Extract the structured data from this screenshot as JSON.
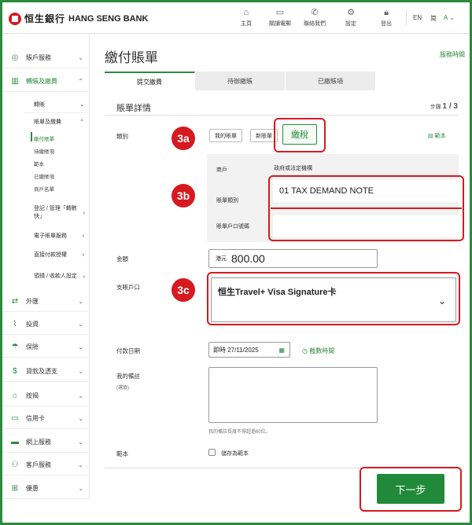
{
  "header": {
    "logo_cn": "恒生銀行",
    "logo_en": "HANG SENG BANK",
    "nav": [
      {
        "icon": "home-icon",
        "label": "主頁"
      },
      {
        "icon": "card-icon",
        "label": "關讀電郵"
      },
      {
        "icon": "phone-icon",
        "label": "聯絡我們"
      },
      {
        "icon": "gear-icon",
        "label": "設定"
      },
      {
        "icon": "lock-icon",
        "label": "登出"
      }
    ],
    "lang_en": "EN",
    "lang_sc": "简",
    "font_size": "A"
  },
  "sidebar": {
    "items": [
      {
        "icon": "user-icon",
        "label": "賬戶服務"
      },
      {
        "icon": "transfer-icon",
        "label": "轉賬及繳費"
      }
    ],
    "sub": [
      {
        "label": "轉賬"
      },
      {
        "label": "賬單及繳費"
      }
    ],
    "sub3": [
      "繳付賬單",
      "待繳賬項",
      "範本",
      "已繳賬項",
      "商戶名單"
    ],
    "sub_more": [
      "登記 / 管理「轉數快」",
      "電子賬單服務",
      "直接付款授權",
      "領錢 / 收款人設定"
    ],
    "bottom": [
      {
        "icon": "fx-icon",
        "label": "外匯"
      },
      {
        "icon": "chart-icon",
        "label": "投資"
      },
      {
        "icon": "umbrella-icon",
        "label": "保險"
      },
      {
        "icon": "money-icon",
        "label": "貸款及透支"
      },
      {
        "icon": "house-icon",
        "label": "按揭"
      },
      {
        "icon": "creditcard-icon",
        "label": "信用卡"
      },
      {
        "icon": "laptop-icon",
        "label": "網上服務"
      },
      {
        "icon": "people-icon",
        "label": "客戶服務"
      },
      {
        "icon": "gift-icon",
        "label": "優惠"
      }
    ]
  },
  "main": {
    "title": "繳付賬單",
    "service_hours": "服務時間",
    "tabs": [
      "提交繳費",
      "待辦繳賬",
      "已繳賬項"
    ],
    "section_title": "賬單詳情",
    "step_prefix": "步驟",
    "step_value": "1 / 3",
    "category_label": "類別",
    "chips": [
      "我的賬單",
      "新賬單",
      "繳稅"
    ],
    "template_link": "範本",
    "merchant_label": "商戶",
    "merchant_value": "政府或法定機構",
    "bill_type_label": "賬單類別",
    "bill_type_value": "01 TAX DEMAND NOTE",
    "bill_account_label": "賬單戶口號碼",
    "amount_label": "金額",
    "currency": "港元",
    "amount_value": "800.00",
    "account_label": "支賬戶口",
    "account_value": "恒生Travel+ Visa Signature卡",
    "date_label": "付款日期",
    "date_value": "即時 27/11/2025",
    "cutoff_link": "截數時間",
    "remark_label": "我的備註",
    "remark_optional": "(選填)",
    "remark_hint": "我的備註長度不得超過60位。",
    "template_label": "範本",
    "save_template": "儲存為範本",
    "next_button": "下一步"
  },
  "annotations": {
    "a": "3a",
    "b": "3b",
    "c": "3c"
  },
  "colors": {
    "brand_green": "#2d8a3e",
    "brand_red": "#d71920"
  }
}
